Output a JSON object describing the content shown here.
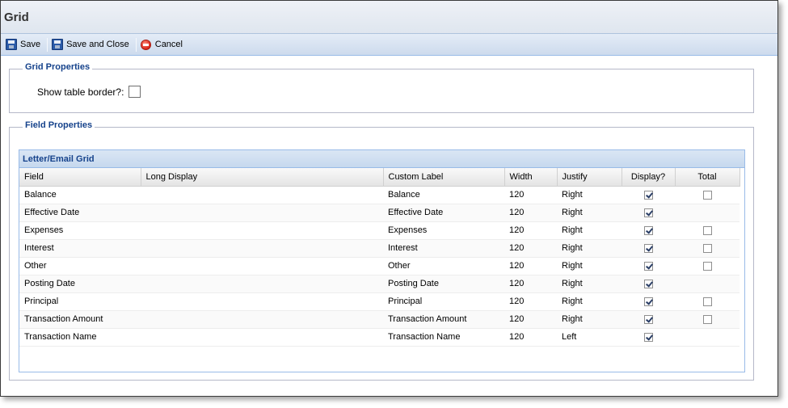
{
  "window": {
    "title": "Grid"
  },
  "toolbar": {
    "save_label": "Save",
    "save_close_label": "Save and Close",
    "cancel_label": "Cancel"
  },
  "grid_properties": {
    "legend": "Grid Properties",
    "show_border_label": "Show table border?:",
    "show_border_checked": false
  },
  "field_properties": {
    "legend": "Field Properties",
    "grid_title": "Letter/Email Grid",
    "columns": [
      "Field",
      "Long Display",
      "Custom Label",
      "Width",
      "Justify",
      "Display?",
      "Total"
    ],
    "rows": [
      {
        "field": "Balance",
        "long_display": "",
        "custom_label": "Balance",
        "width": "120",
        "justify": "Right",
        "display": true,
        "total": false,
        "has_total": true
      },
      {
        "field": "Effective Date",
        "long_display": "",
        "custom_label": "Effective Date",
        "width": "120",
        "justify": "Right",
        "display": true,
        "total": false,
        "has_total": false
      },
      {
        "field": "Expenses",
        "long_display": "",
        "custom_label": "Expenses",
        "width": "120",
        "justify": "Right",
        "display": true,
        "total": false,
        "has_total": true
      },
      {
        "field": "Interest",
        "long_display": "",
        "custom_label": "Interest",
        "width": "120",
        "justify": "Right",
        "display": true,
        "total": false,
        "has_total": true
      },
      {
        "field": "Other",
        "long_display": "",
        "custom_label": "Other",
        "width": "120",
        "justify": "Right",
        "display": true,
        "total": false,
        "has_total": true
      },
      {
        "field": "Posting Date",
        "long_display": "",
        "custom_label": "Posting Date",
        "width": "120",
        "justify": "Right",
        "display": true,
        "total": false,
        "has_total": false
      },
      {
        "field": "Principal",
        "long_display": "",
        "custom_label": "Principal",
        "width": "120",
        "justify": "Right",
        "display": true,
        "total": false,
        "has_total": true
      },
      {
        "field": "Transaction Amount",
        "long_display": "",
        "custom_label": "Transaction Amount",
        "width": "120",
        "justify": "Right",
        "display": true,
        "total": false,
        "has_total": true
      },
      {
        "field": "Transaction Name",
        "long_display": "",
        "custom_label": "Transaction Name",
        "width": "120",
        "justify": "Left",
        "display": true,
        "total": false,
        "has_total": false
      }
    ]
  }
}
